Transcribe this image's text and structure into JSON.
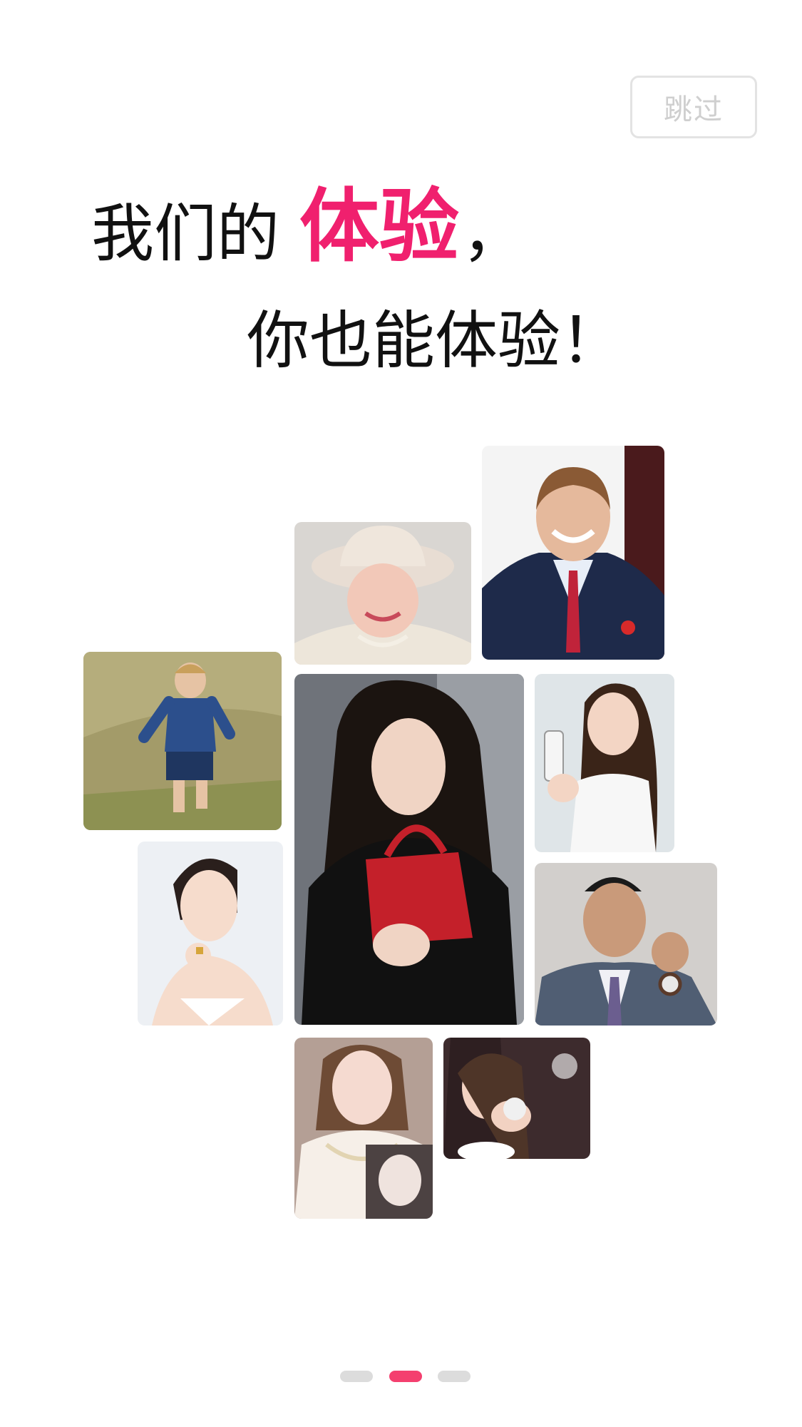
{
  "header": {
    "skip_label": "跳过"
  },
  "headline": {
    "line1_prefix": "我们的",
    "line1_accent": "体验",
    "line1_suffix": "，",
    "line2": "你也能体验！"
  },
  "colors": {
    "accent": "#f0206e",
    "dot_active": "#f43f6f",
    "dot_inactive": "#dcdcdc",
    "text": "#111111"
  },
  "pager": {
    "total": 3,
    "active_index": 1
  }
}
